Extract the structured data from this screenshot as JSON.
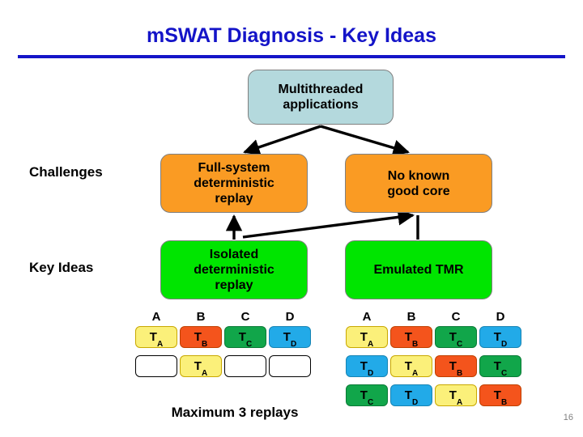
{
  "slide": {
    "title": "mSWAT Diagnosis - Key Ideas",
    "page_number": "16",
    "title_color": "#1414C8",
    "rule_color": "#1414C8"
  },
  "row_labels": {
    "challenges": "Challenges",
    "key_ideas": "Key Ideas"
  },
  "boxes": {
    "multithreaded": {
      "label": "Multithreaded\napplications",
      "line1": "Multithreaded",
      "line2": "applications",
      "color": "#B4D9DD"
    },
    "full_system": {
      "line1": "Full-system",
      "line2": "deterministic",
      "line3": "replay",
      "color": "#FA9B23"
    },
    "no_known_core": {
      "line1": "No known",
      "line2": "good core",
      "color": "#FA9B23"
    },
    "isolated_replay": {
      "line1": "Isolated",
      "line2": "deterministic",
      "line3": "replay",
      "color": "#00E500"
    },
    "emulated_tmr": {
      "line1": "Emulated TMR",
      "color": "#00E500"
    }
  },
  "left_grid": {
    "headers": [
      "A",
      "B",
      "C",
      "D"
    ],
    "rows": [
      [
        {
          "text": "T",
          "sub": "A",
          "color": "yellow"
        },
        {
          "text": "T",
          "sub": "B",
          "color": "orange"
        },
        {
          "text": "T",
          "sub": "C",
          "color": "green"
        },
        {
          "text": "T",
          "sub": "D",
          "color": "blue"
        }
      ],
      [
        {
          "text": "",
          "sub": "",
          "color": "empty"
        },
        {
          "text": "T",
          "sub": "A",
          "color": "yellow"
        },
        {
          "text": "",
          "sub": "",
          "color": "empty"
        },
        {
          "text": "",
          "sub": "",
          "color": "empty"
        }
      ]
    ],
    "caption": "Maximum 3 replays"
  },
  "right_grid": {
    "headers": [
      "A",
      "B",
      "C",
      "D"
    ],
    "rows": [
      [
        {
          "text": "T",
          "sub": "A",
          "color": "yellow"
        },
        {
          "text": "T",
          "sub": "B",
          "color": "orange"
        },
        {
          "text": "T",
          "sub": "C",
          "color": "green"
        },
        {
          "text": "T",
          "sub": "D",
          "color": "blue"
        }
      ],
      [
        {
          "text": "T",
          "sub": "D",
          "color": "blue"
        },
        {
          "text": "T",
          "sub": "A",
          "color": "yellow"
        },
        {
          "text": "T",
          "sub": "B",
          "color": "orange"
        },
        {
          "text": "T",
          "sub": "C",
          "color": "green"
        }
      ],
      [
        {
          "text": "T",
          "sub": "C",
          "color": "green"
        },
        {
          "text": "T",
          "sub": "D",
          "color": "blue"
        },
        {
          "text": "T",
          "sub": "A",
          "color": "yellow"
        },
        {
          "text": "T",
          "sub": "B",
          "color": "orange"
        }
      ]
    ]
  },
  "palette": {
    "yellow": "#FBF07A",
    "orange": "#F4541C",
    "green": "#11A64A",
    "blue": "#22AAE8",
    "box_orange": "#FA9B23",
    "box_green": "#00E500",
    "box_cyan": "#B4D9DD"
  }
}
